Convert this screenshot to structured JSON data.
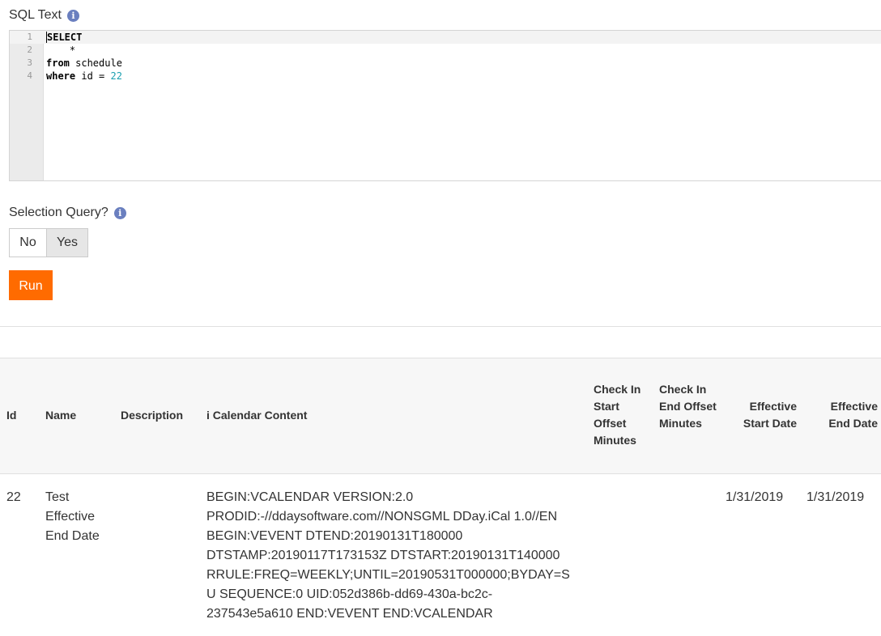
{
  "sql_text": {
    "label": "SQL Text",
    "info_icon": "info-icon",
    "lines": [
      {
        "num": "1",
        "parts": [
          {
            "t": "SELECT",
            "c": "kw"
          }
        ]
      },
      {
        "num": "2",
        "parts": [
          {
            "t": "    *",
            "c": ""
          }
        ]
      },
      {
        "num": "3",
        "parts": [
          {
            "t": "from",
            "c": "kw"
          },
          {
            "t": " schedule",
            "c": ""
          }
        ]
      },
      {
        "num": "4",
        "parts": [
          {
            "t": "where",
            "c": "kw"
          },
          {
            "t": " id = ",
            "c": ""
          },
          {
            "t": "22",
            "c": "num"
          }
        ]
      }
    ]
  },
  "selection_query": {
    "label": "Selection Query?",
    "info_icon": "info-icon",
    "options": [
      "No",
      "Yes"
    ],
    "selected": "Yes"
  },
  "run_button": {
    "label": "Run"
  },
  "table": {
    "headers": {
      "id": "Id",
      "name": "Name",
      "description": "Description",
      "icalendar": "i Calendar Content",
      "checkin_start": "Check In Start Offset Minutes",
      "checkin_end": "Check In End Offset Minutes",
      "eff_start": "Effective Start Date",
      "eff_end": "Effective End Date"
    },
    "row": {
      "id": "22",
      "name": "Test Effective End Date",
      "description": "",
      "icalendar": "BEGIN:VCALENDAR VERSION:2.0 PRODID:-//ddaysoftware.com//NONSGML DDay.iCal 1.0//EN BEGIN:VEVENT DTEND:20190131T180000 DTSTAMP:20190117T173153Z DTSTART:20190131T140000 RRULE:FREQ=WEEKLY;UNTIL=20190531T000000;BYDAY=SU SEQUENCE:0 UID:052d386b-dd69-430a-bc2c-237543e5a610 END:VEVENT END:VCALENDAR",
      "checkin_start": "",
      "checkin_end": "",
      "eff_start": "1/31/2019",
      "eff_end": "1/31/2019"
    }
  }
}
